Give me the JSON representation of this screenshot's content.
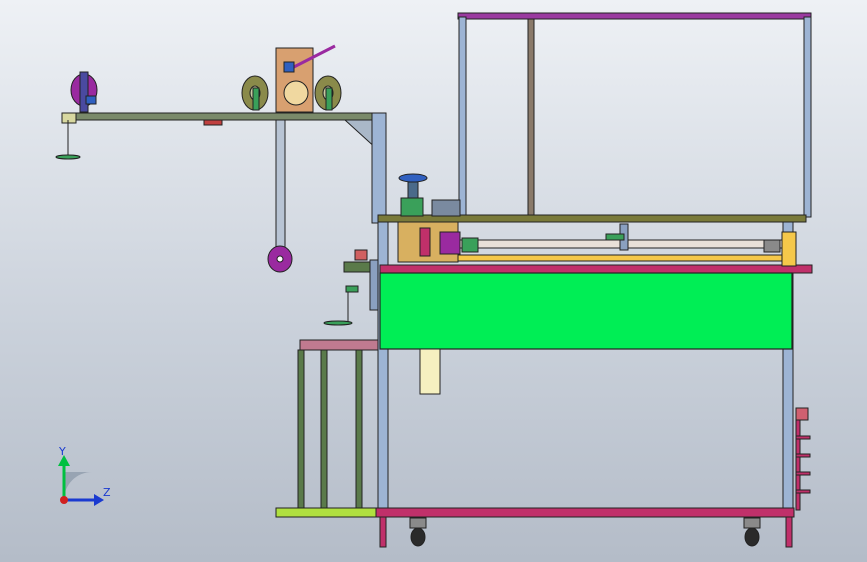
{
  "viewport": {
    "triad": {
      "y_label": "Y",
      "z_label": "Z"
    },
    "colors": {
      "frame_blue": "#9db4d4",
      "top_frame": "#9a3aa0",
      "green_panel": "#00ee55",
      "rail_yellow": "#f5c84a",
      "base_pink": "#c0306a",
      "shelf_pink": "#c07a90",
      "olive": "#7a7a3a",
      "wood": "#d8a070",
      "purple_reel": "#9a2aa0"
    }
  }
}
